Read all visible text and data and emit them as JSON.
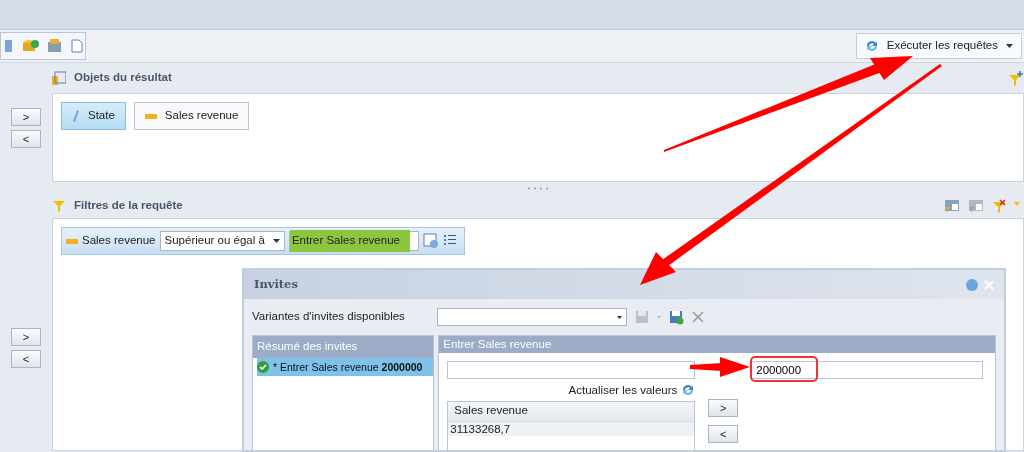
{
  "toolbar": {
    "run_button": "Exécuter les requêtes"
  },
  "result_objects": {
    "title": "Objets du résultat",
    "items": [
      {
        "label": "State",
        "kind": "dimension",
        "selected": true
      },
      {
        "label": "Sales revenue",
        "kind": "measure",
        "selected": false
      }
    ],
    "move_buttons": [
      ">",
      "<"
    ]
  },
  "query_filters": {
    "title": "Filtres de la requête",
    "filter": {
      "object": "Sales revenue",
      "operator": "Supérieur ou égal à",
      "prompt": "Entrer Sales revenue",
      "highlighted": true
    },
    "move_buttons": [
      ">",
      "<"
    ]
  },
  "prompts_dialog": {
    "title": "Invites",
    "variants_label": "Variantes d'invites disponibles",
    "summary": {
      "title": "Résumé des invites",
      "items": [
        {
          "text": "* Entrer Sales revenue **2000000**",
          "selected": true,
          "valid": true
        }
      ]
    },
    "entry": {
      "title": "Entrer Sales revenue",
      "refresh": "Actualiser les valeurs",
      "list": {
        "column": "Sales revenue",
        "rows": [
          "31133268,7"
        ]
      },
      "value": "2000000",
      "buttons": [
        ">",
        "<"
      ]
    }
  }
}
